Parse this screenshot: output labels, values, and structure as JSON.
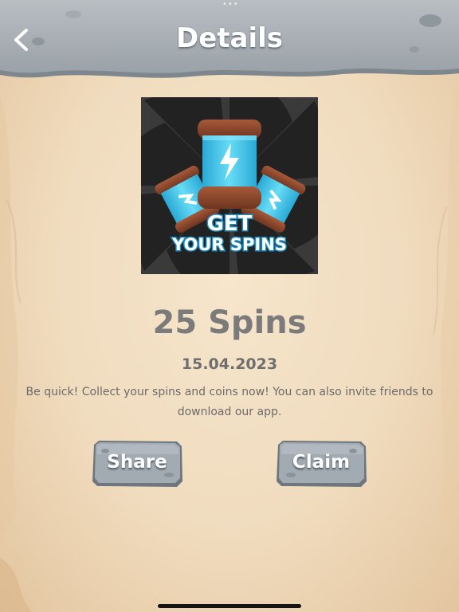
{
  "header": {
    "title": "Details",
    "back_icon": "chevron-left-icon"
  },
  "promo": {
    "image_alt": "GET YOUR SPINS",
    "line1": "GET",
    "line2": "YOUR SPINS"
  },
  "reward": {
    "title": "25 Spins",
    "date": "15.04.2023",
    "description": "Be quick! Collect your spins and coins now! You can also invite friends to download our app."
  },
  "actions": {
    "share_label": "Share",
    "claim_label": "Claim"
  },
  "colors": {
    "header_stone": "#a9b0b6",
    "background": "#f0dcc0",
    "button_stone": "#9aa3ab",
    "spin_blue": "#3fc4ea",
    "rim_brown": "#8f4a2d"
  }
}
